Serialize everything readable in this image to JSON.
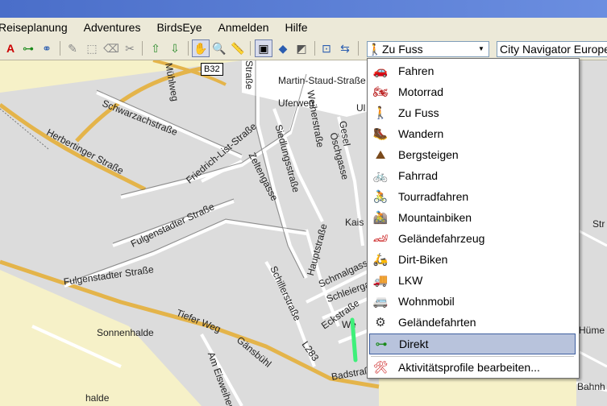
{
  "menu": {
    "items": [
      "Reiseplanung",
      "Adventures",
      "BirdsEye",
      "Anmelden",
      "Hilfe"
    ]
  },
  "toolbar": {
    "tooltip": "B32",
    "profile_combo": "Zu Fuss",
    "map_combo": "City Navigator Europe"
  },
  "profile_menu": {
    "items": [
      {
        "label": "Fahren",
        "icon": "car-icon"
      },
      {
        "label": "Motorrad",
        "icon": "motorcycle-icon"
      },
      {
        "label": "Zu Fuss",
        "icon": "walking-icon"
      },
      {
        "label": "Wandern",
        "icon": "hiking-icon"
      },
      {
        "label": "Bergsteigen",
        "icon": "mountain-icon"
      },
      {
        "label": "Fahrrad",
        "icon": "bicycle-icon"
      },
      {
        "label": "Tourradfahren",
        "icon": "touring-bike-icon"
      },
      {
        "label": "Mountainbiken",
        "icon": "mountain-bike-icon"
      },
      {
        "label": "Geländefahrzeug",
        "icon": "atv-icon"
      },
      {
        "label": "Dirt-Biken",
        "icon": "dirt-bike-icon"
      },
      {
        "label": "LKW",
        "icon": "truck-icon"
      },
      {
        "label": "Wohnmobil",
        "icon": "rv-icon"
      },
      {
        "label": "Geländefahrten",
        "icon": "offroad-icon"
      },
      {
        "label": "Direkt",
        "icon": "direct-route-icon"
      }
    ],
    "selected": "Direkt",
    "edit_label": "Aktivitätsprofile bearbeiten..."
  },
  "map": {
    "labels": {
      "martin": "Martin-Staud-Straße",
      "uferweg": "Uferweg",
      "schwarzach": "Schwarzachstraße",
      "herbertinger": "Herbertinger Straße",
      "friedrich": "Friedrich-List-Straße",
      "siedlung": "Siedlungsstraße",
      "weiher": "Weiherstraße",
      "zelten": "Zeltengasse",
      "fulgen1": "Fulgenstadter Straße",
      "fulgen2": "Fulgenstadter Straße",
      "tiefer": "Tiefer Weg",
      "sonnenhalde": "Sonnenhalde",
      "gansbuhl": "Gänsbühl",
      "ameisen": "Am Eisweiher",
      "haupt": "Hauptstraße",
      "schiller": "Schillerstraße",
      "schmal": "Schmalgasse",
      "schleier": "Schleiergasse",
      "eck": "Eckstraße",
      "bad": "Badstraße",
      "l283": "L283",
      "kais": "Kais",
      "halde": "halde",
      "strasse_top": "Straße",
      "muhlweg": "Mühlweg",
      "ul": "Ul",
      "gesel": "Gesel",
      "oschgasse": "Öschgasse",
      "we": "We",
      "hume": "Hüme",
      "bahnh": "Bahnh",
      "strs": "Str"
    }
  }
}
